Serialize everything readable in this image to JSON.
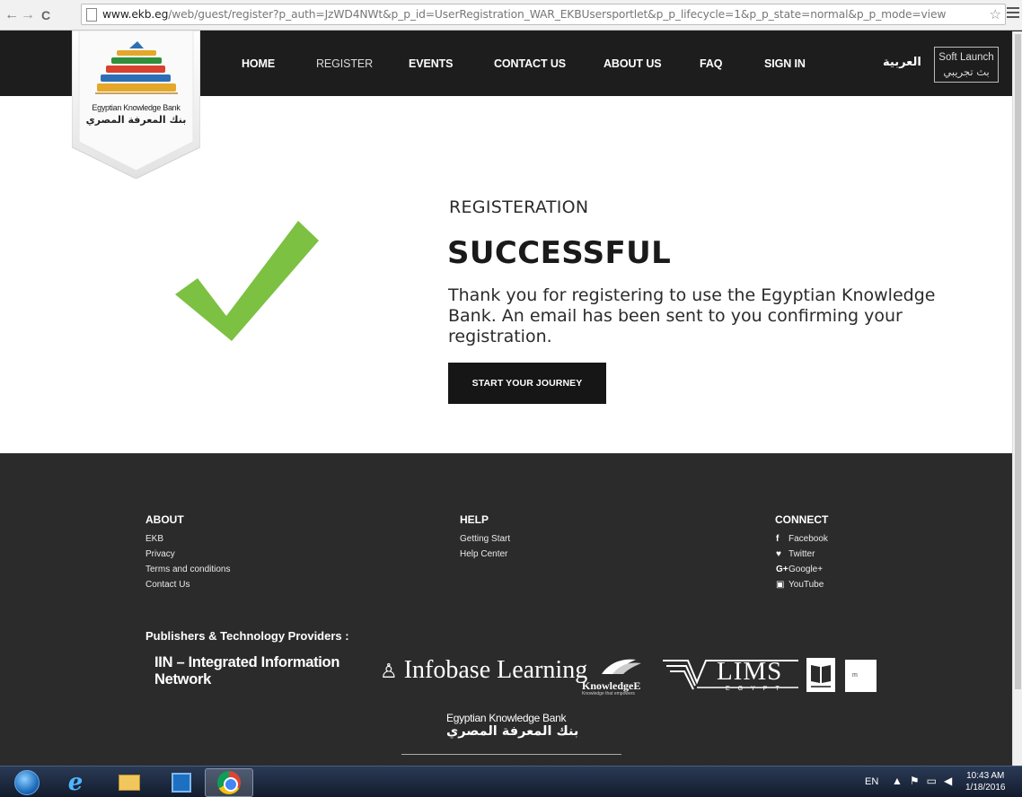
{
  "browser": {
    "url_host": "www.ekb.eg",
    "url_path": "/web/guest/register?p_auth=JzWD4NWt&p_p_id=UserRegistration_WAR_EKBUsersportlet&p_p_lifecycle=1&p_p_state=normal&p_p_mode=view",
    "back_icon": "←",
    "forward_icon": "→",
    "reload_icon": "C",
    "star_icon": "☆"
  },
  "header": {
    "logo_en": "Egyptian Knowledge Bank",
    "logo_ar": "بنك المعرفة المصري",
    "nav": {
      "home": "HOME",
      "register": "REGISTER",
      "events": "EVENTS",
      "contact": "CONTACT US",
      "about": "ABOUT US",
      "faq": "FAQ",
      "signin": "SIGN IN",
      "arabic": "العربية"
    },
    "soft_launch_en": "Soft Launch",
    "soft_launch_ar": "بث تجريبي"
  },
  "main": {
    "label": "REGISTERATION",
    "title": "SUCCESSFUL",
    "message": "Thank you for registering to use the Egyptian Knowledge Bank. An email has been sent to you confirming your registration.",
    "button": "START YOUR JOURNEY",
    "check_color": "#7cc142"
  },
  "footer": {
    "about_title": "ABOUT",
    "about_links": [
      "EKB",
      "Privacy",
      "Terms and conditions",
      "Contact Us"
    ],
    "help_title": "HELP",
    "help_links": [
      "Getting Start",
      "Help Center"
    ],
    "connect_title": "CONNECT",
    "connect_links": [
      {
        "icon": "f",
        "label": "Facebook"
      },
      {
        "icon": "♥",
        "label": "Twitter"
      },
      {
        "icon": "G+",
        "label": "Google+"
      },
      {
        "icon": "▣",
        "label": "YouTube"
      }
    ],
    "publishers_title": "Publishers & Technology Providers :",
    "publishers": {
      "iin_line1": "IIN – Integrated Information",
      "iin_line2": "Network",
      "infobase": "Infobase Learning",
      "knowledgee": "KnowledgeE",
      "knowledgee_tag": "Knowledge that empowers",
      "lims": "LIMS",
      "lims_sub": "EGYPT",
      "white_logo_text": "m"
    },
    "logo_en": "Egyptian Knowledge Bank",
    "logo_ar": "بنك المعرفة المصري"
  },
  "taskbar": {
    "language": "EN",
    "time": "10:43 AM",
    "date": "1/18/2016"
  }
}
